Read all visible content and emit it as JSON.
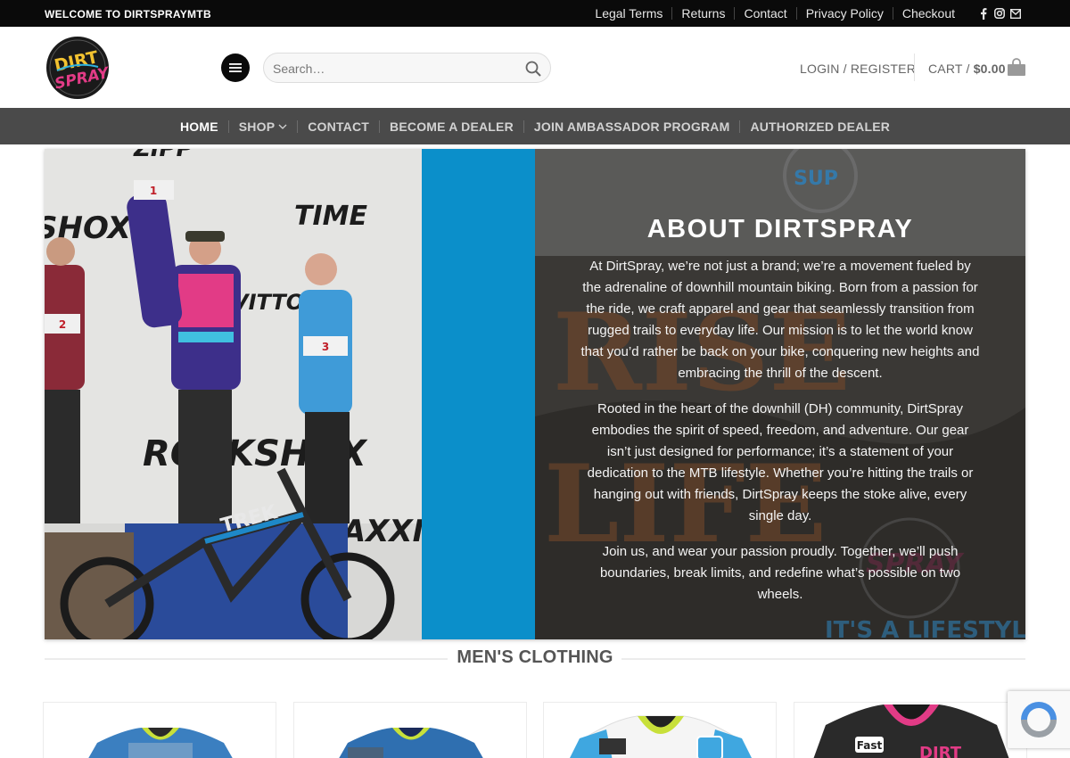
{
  "topbar": {
    "welcome": "WELCOME TO DIRTSPRAYMTB",
    "links": [
      "Legal Terms",
      "Returns",
      "Contact",
      "Privacy Policy",
      "Checkout"
    ],
    "social_icons": [
      "facebook-icon",
      "instagram-icon",
      "email-icon"
    ]
  },
  "header": {
    "logo_text": "DIRT SPRAY",
    "search_placeholder": "Search…",
    "login_label": "LOGIN / REGISTER",
    "cart_label": "CART /",
    "cart_amount": "$0.00"
  },
  "nav": {
    "items": [
      "HOME",
      "SHOP",
      "CONTACT",
      "BECOME A DEALER",
      "JOIN AMBASSADOR PROGRAM",
      "AUTHORIZED DEALER"
    ],
    "active": "HOME"
  },
  "hero": {
    "title": "ABOUT DIRTSPRAY",
    "paragraphs": [
      "At DirtSpray, we’re not just a brand; we’re a movement fueled by the adrenaline of downhill mountain biking. Born from a passion for the ride, we craft apparel and gear that seamlessly transition from rugged trails to everyday life. Our mission is to let the world know that you’d rather be back on your bike, conquering new heights and embracing the thrill of the descent.",
      "Rooted in the heart of the downhill (DH) community, DirtSpray embodies the spirit of speed, freedom, and adventure. Our gear isn’t just designed for performance; it’s a statement of your dedication to the MTB lifestyle. Whether you’re hitting the trails or hanging out with friends, DirtSpray keeps the stoke alive, every single day.",
      "Join us, and wear your passion proudly. Together, we’ll push boundaries, break limits, and redefine what’s possible on two wheels."
    ],
    "background_text": "IT'S A LIFESTYLE...",
    "photo_banner_words": [
      "ZIPP",
      "SHOX",
      "TIME",
      "VITTORIA",
      "ROCKSHOX",
      "MAXXIS",
      "TREK"
    ],
    "photo_podium_numbers": [
      "1",
      "2",
      "3"
    ]
  },
  "section": {
    "title": "MEN'S CLOTHING"
  },
  "colors": {
    "topbar": "#0a0a0a",
    "nav": "#4a4a4a",
    "hero_strip": "#0b8fca",
    "accent_pink": "#e23b86"
  }
}
